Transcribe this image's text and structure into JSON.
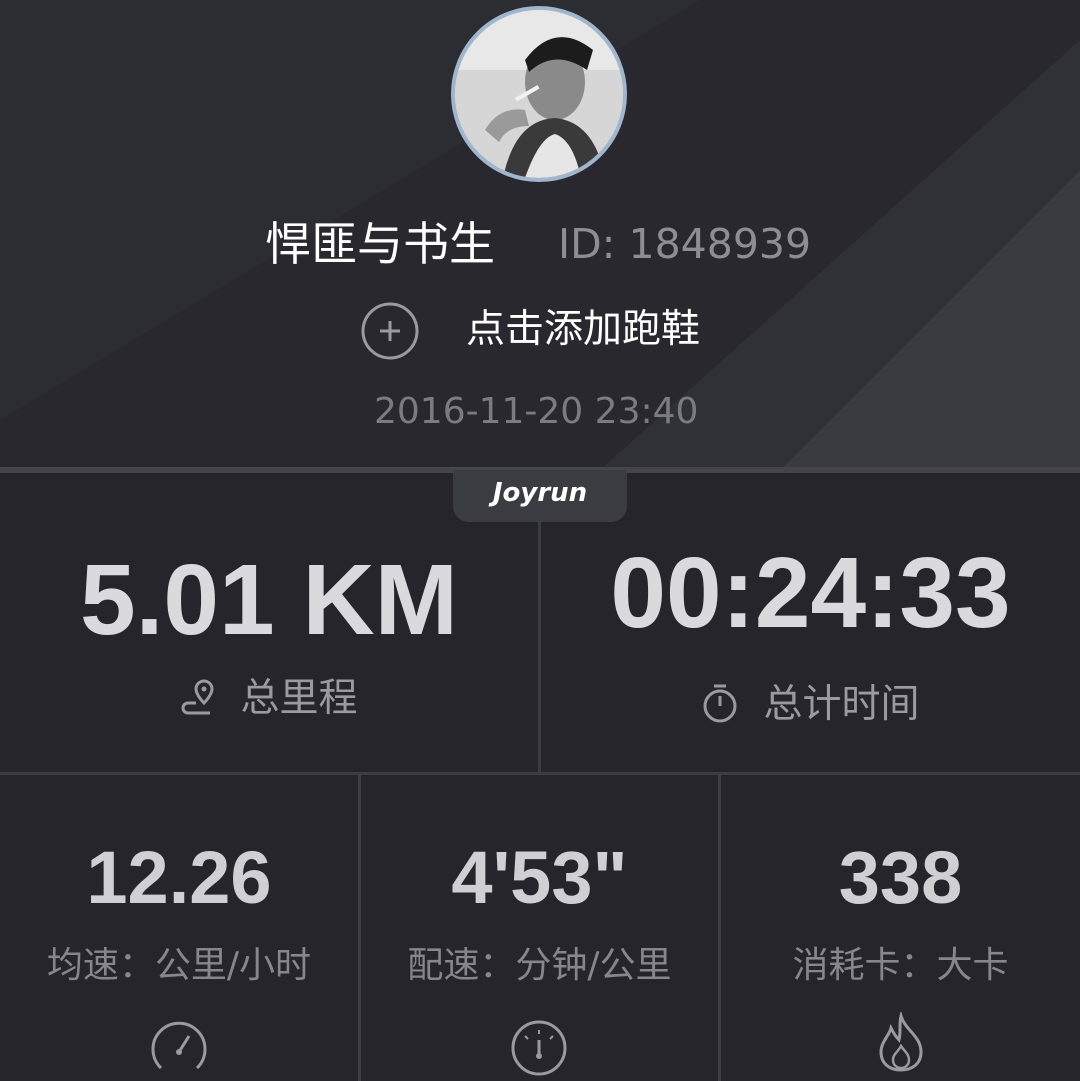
{
  "profile": {
    "nickname": "悍匪与书生",
    "id_text": "ID: 1848939",
    "add_shoe_label": "点击添加跑鞋",
    "run_datetime": "2016-11-20 23:40"
  },
  "brand": "Joyrun",
  "stats": {
    "distance": {
      "value": "5.01 KM",
      "label": "总里程",
      "icon": "route-icon"
    },
    "duration": {
      "value": "00:24:33",
      "label": "总计时间",
      "icon": "stopwatch-icon"
    },
    "speed": {
      "value": "12.26",
      "label": "均速：公里/小时",
      "icon": "speedometer-icon"
    },
    "pace": {
      "value": "4'53\"",
      "label": "配速：分钟/公里",
      "icon": "gauge-icon"
    },
    "calories": {
      "value": "338",
      "label": "消耗卡：大卡",
      "icon": "flame-icon"
    }
  },
  "colors": {
    "background": "#25252b",
    "avatar_border": "#9fb6cc",
    "value_text": "#d9d9de",
    "label_text": "#9a9aa0"
  }
}
